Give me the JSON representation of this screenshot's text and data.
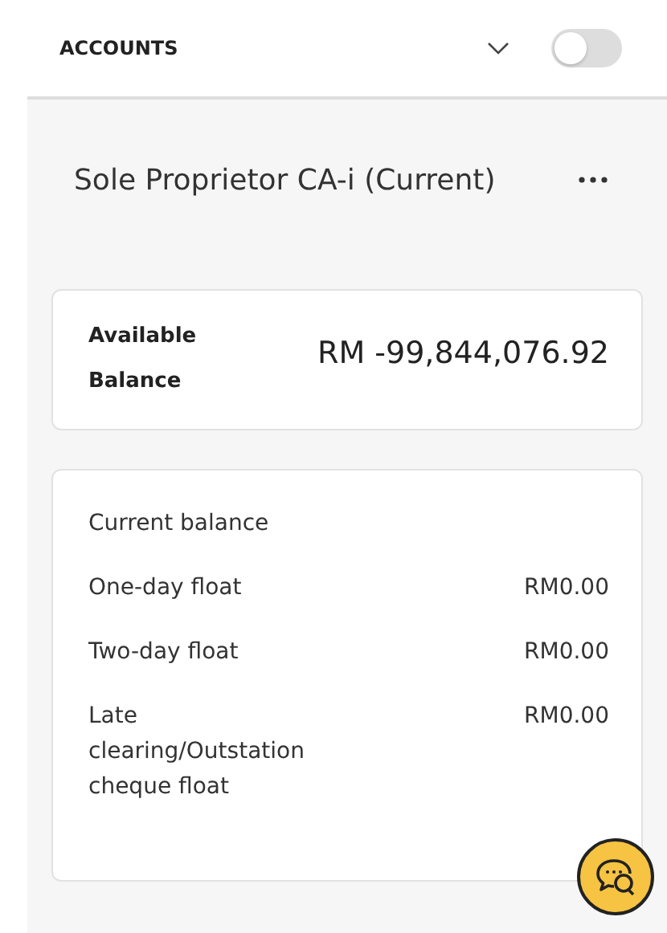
{
  "header": {
    "title": "ACCOUNTS",
    "toggle": {
      "on": false
    }
  },
  "account": {
    "name": "Sole Proprietor CA-i (Current)"
  },
  "available": {
    "label": "Available Balance",
    "amount": "RM -99,844,076.92"
  },
  "details": [
    {
      "label": "Current balance"
    },
    {
      "label": "One-day float",
      "value": "RM0.00"
    },
    {
      "label": "Two-day float",
      "value": "RM0.00"
    },
    {
      "label": "Late clearing/Outstation cheque float",
      "value": "RM0.00"
    }
  ]
}
